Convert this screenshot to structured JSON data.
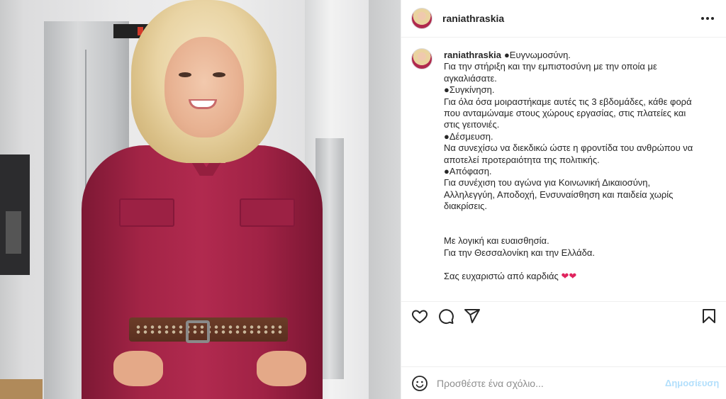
{
  "post": {
    "username": "raniathraskia",
    "caption_lines": [
      "●Ευγνωμοσύνη.",
      "Για την στήριξη και την εμπιστοσύνη με την οποία με",
      "αγκαλιάσατε.",
      "●Συγκίνηση.",
      "Για όλα όσα μοιραστήκαμε αυτές τις 3 εβδομάδες, κάθε φορά",
      "που ανταμώναμε στους χώρους εργασίας, στις πλατείες και",
      "στις γειτονιές.",
      "●Δέσμευση.",
      "Να συνεχίσω να διεκδικώ ώστε η φροντίδα του ανθρώπου να",
      "αποτελεί προτεραιότητα της πολιτικής.",
      "●Απόφαση.",
      "Για συνέχιση του αγώνα για Κοινωνική Δικαιοσύνη,",
      "Αλληλεγγύη, Αποδοχή, Ενσυναίσθηση και παιδεία χωρίς",
      "διακρίσεις."
    ],
    "closing_lines": [
      "Με λογική και ευαισθησία.",
      "Για την Θεσσαλονίκη και την Ελλάδα."
    ],
    "thanks_line": "Σας ευχαριστώ από καρδιάς",
    "thanks_emoji": "❤❤"
  },
  "comment": {
    "placeholder": "Προσθέστε ένα σχόλιο...",
    "post_label": "Δημοσίευση"
  },
  "icons": [
    "more-options-icon",
    "like-heart-icon",
    "comment-icon",
    "share-icon",
    "save-bookmark-icon",
    "emoji-icon"
  ],
  "colors": {
    "dress": "#a32446",
    "post_button_disabled": "#b2dffc",
    "text": "#262626",
    "placeholder": "#8e8e8e"
  }
}
